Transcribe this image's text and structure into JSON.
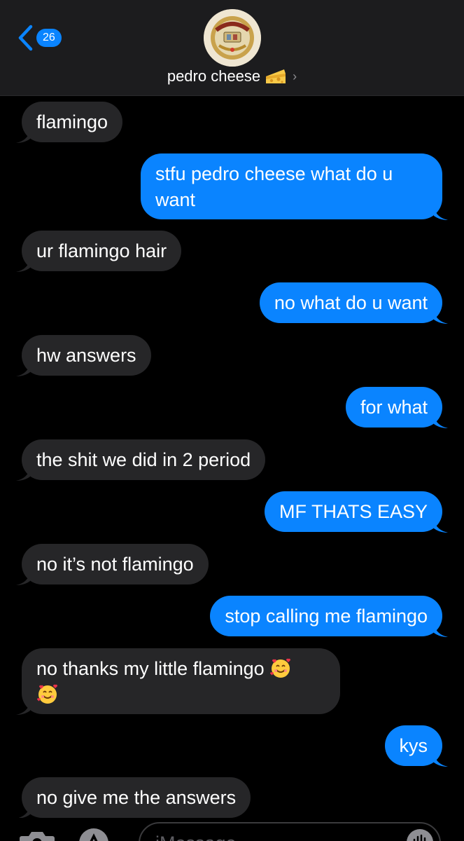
{
  "header": {
    "back_count": "26",
    "contact_name": "pedro cheese",
    "contact_emoji": "cheese-icon",
    "chevron": "›"
  },
  "messages": [
    {
      "from": "them",
      "text": "flamingo"
    },
    {
      "from": "me",
      "text": "stfu pedro cheese what do u want"
    },
    {
      "from": "them",
      "text": "ur flamingo hair"
    },
    {
      "from": "me",
      "text": "no what do u want"
    },
    {
      "from": "them",
      "text": "hw answers"
    },
    {
      "from": "me",
      "text": "for what"
    },
    {
      "from": "them",
      "text": "the shit we did in 2 period"
    },
    {
      "from": "me",
      "text": "MF THATS EASY"
    },
    {
      "from": "them",
      "text": "no it’s not flamingo"
    },
    {
      "from": "me",
      "text": "stop calling me flamingo"
    },
    {
      "from": "them",
      "text": "no thanks my little flamingo",
      "emojis": [
        "smiling-face-with-hearts",
        "smiling-face-with-hearts"
      ]
    },
    {
      "from": "me",
      "text": "kys"
    },
    {
      "from": "them",
      "text": "no give me the answers"
    }
  ],
  "input": {
    "placeholder": "iMessage"
  },
  "colors": {
    "incoming_bubble": "#262628",
    "outgoing_bubble": "#0a84ff",
    "header_bg": "#1c1c1e",
    "accent": "#0a84ff"
  }
}
